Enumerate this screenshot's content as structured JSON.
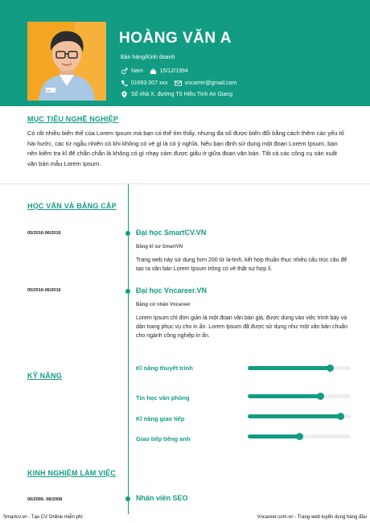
{
  "profile": {
    "name": "HOÀNG VĂN A",
    "job_title": "Bán hàng/Kinh doanh",
    "gender": "Nam",
    "birthday": "15/12/1994",
    "phone": "01693 007 xxx",
    "email": "vncarrer@gmail.com",
    "address": "Số nhà X, đường Tô Hiệu Tỉnh An Giang"
  },
  "objective": {
    "title": "MỤC TIÊU NGHỀ NGHIỆP",
    "text": "Có rất nhiều biến thể của Lorem Ipsum mà bạn có thể tìm thấy, nhưng đa số được biến đổi bằng cách thêm các yếu tố hài hước, các từ ngẫu nhiên có khi không có vẻ gì là có ý nghĩa. Nếu bạn định sử dụng một đoạn Lorem Ipsum, bạn nên kiểm tra kĩ để chắn chắn là không có gì nhạy cảm được giấu ở giữa đoạn văn bản. Tất cả các công cụ sản xuất văn bản mẫu Lorem Ipsum."
  },
  "education": {
    "title": "HỌC VẤN VÀ BẰNG CẤP",
    "entries": [
      {
        "date": "05/2016-06/2016",
        "school": "Đại học SmartCV.VN",
        "degree": "Bằng kĩ sư SmartVN",
        "desc": "Trang web này sử dụng hơn 200 từ la-tinh, kết hợp thuần thục nhiều cấu trúc câu để tạo ra văn bản Lorem Ipsum trông có vẻ thật sự hợp lí."
      },
      {
        "date": "05/2016-06/2016",
        "school": "Đại học Vncareer.VN",
        "degree": "Bằng cử nhân Vncareer",
        "desc": "Lorem Ipsum chỉ đơn giản là một đoạn văn bản giả, được dùng vào việc trình bày và dàn trang phục vụ cho in ấn. Lorem Ipsum đã được sử dụng như một văn bản chuẩn cho ngành công nghiệp in ấn."
      }
    ]
  },
  "skills": {
    "title": "KỸ NĂNG",
    "items": [
      {
        "label": "Kĩ năng thuyết trình",
        "level": 0.8
      },
      {
        "label": "Tin học văn phòng",
        "level": 0.7
      },
      {
        "label": "Kĩ năng giao tiếp",
        "level": 0.9
      },
      {
        "label": "Giao tiếp tiếng anh",
        "level": 0.5
      }
    ]
  },
  "experience": {
    "title": "KINH NGHIỆM LÀM VIỆC",
    "entries": [
      {
        "date": "06/2006- 08/2008",
        "position": "Nhân viên SEO"
      }
    ]
  },
  "footer": {
    "left": "Smartcv.vn - Tạo CV Online miễn phí",
    "right": "Vncareer.com.vn - Trang web tuyển dụng hàng đầu"
  },
  "colors": {
    "accent": "#129c83",
    "avatar_bg": "#f4a623"
  }
}
